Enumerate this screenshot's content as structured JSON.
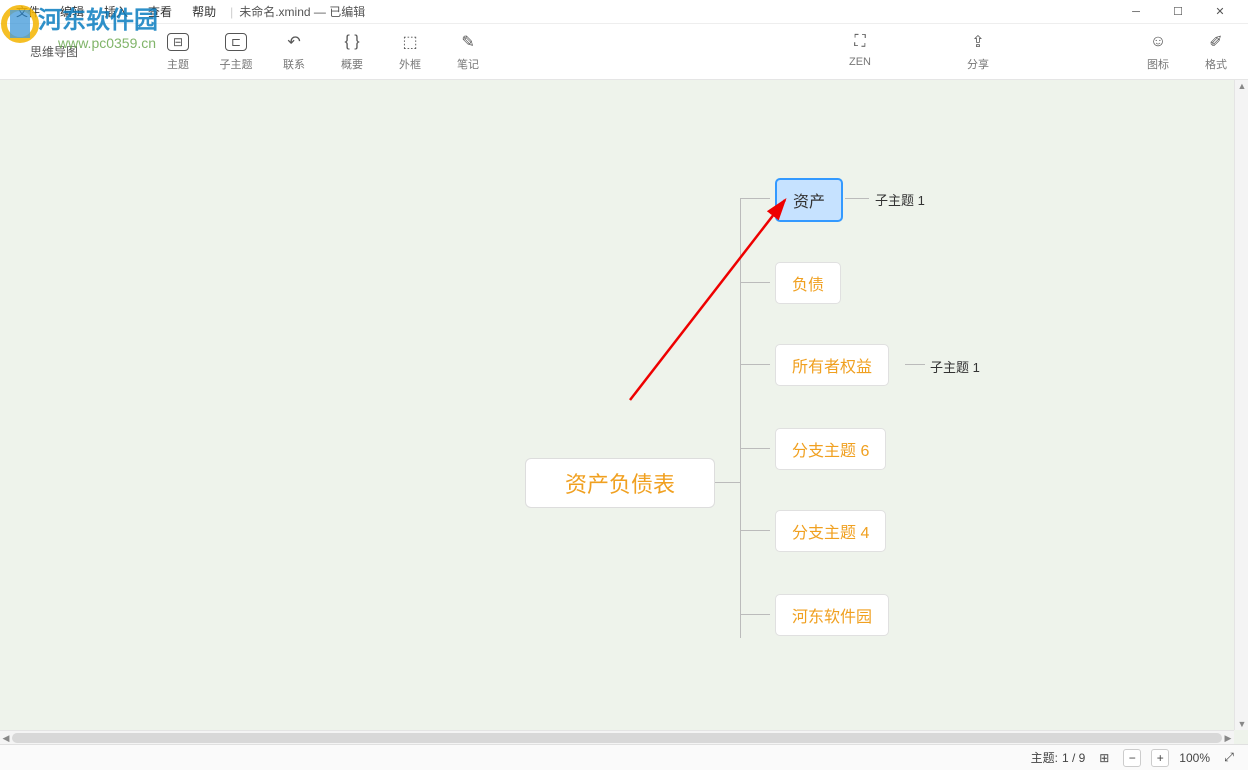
{
  "menu": {
    "file": "文件",
    "edit": "编辑",
    "insert": "插入",
    "view": "查看",
    "help": "帮助"
  },
  "document": {
    "name": "未命名.xmind",
    "status": "已编辑"
  },
  "nav_title": "思维导图",
  "toolbar": {
    "topic": "主题",
    "subtopic": "子主题",
    "relation": "联系",
    "summary": "概要",
    "boundary": "外框",
    "note": "笔记",
    "zen": "ZEN",
    "share": "分享",
    "icon": "图标",
    "format": "格式"
  },
  "mindmap": {
    "center": "资产负债表",
    "branches": [
      {
        "label": "资产",
        "selected": true,
        "sub": "子主题 1"
      },
      {
        "label": "负债"
      },
      {
        "label": "所有者权益",
        "sub": "子主题 1"
      },
      {
        "label": "分支主题 6"
      },
      {
        "label": "分支主题 4"
      },
      {
        "label": "河东软件园"
      }
    ]
  },
  "status": {
    "topic_label": "主题:",
    "topic_count": "1 / 9",
    "zoom": "100%"
  },
  "watermark": {
    "line1": "河东软件园",
    "line2": "www.pc0359.cn"
  }
}
